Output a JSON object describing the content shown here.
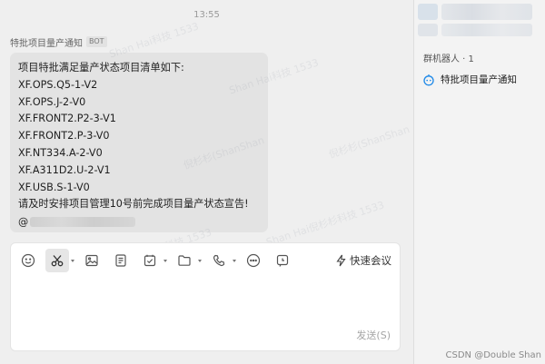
{
  "chat": {
    "time": "13:55",
    "sender": {
      "name": "特批项目量产通知",
      "badge": "BOT"
    },
    "message": {
      "lines": [
        "项目特批满足量产状态项目清单如下:",
        "XF.OPS.Q5-1-V2",
        "XF.OPS.J-2-V0",
        "XF.FRONT2.P2-3-V1",
        "XF.FRONT2.P-3-V0",
        "XF.NT334.A-2-V0",
        "XF.A311D2.U-2-V1",
        "XF.USB.S-1-V0",
        " 请及时安排项目管理10号前完成项目量产状态宣告!"
      ],
      "mention_prefix": "@"
    },
    "watermarks": [
      "Shan Hai科技 1533",
      "Shan Hai科技 1533",
      "倪杉杉(ShanShan",
      "倪杉杉(ShanShan",
      "Shan Hai倪杉杉科技 1533",
      "Shan Hai倪杉杉科技 1533"
    ]
  },
  "composer": {
    "tools": [
      "emoji-icon",
      "scissors-icon",
      "image-icon",
      "document-icon",
      "task-icon",
      "folder-icon",
      "phone-icon",
      "more-icon",
      "schedule-icon"
    ],
    "meeting_label": "快速会议",
    "send_label": "发送(S)"
  },
  "sidebar": {
    "robots_title": "群机器人 · 1",
    "robots": [
      {
        "name": "特批项目量产通知"
      }
    ]
  },
  "footer": {
    "csdn": "CSDN @Double Shan"
  },
  "colors": {
    "accent": "#1f89e8",
    "bubble": "#e3e3e3",
    "background": "#efefef"
  }
}
